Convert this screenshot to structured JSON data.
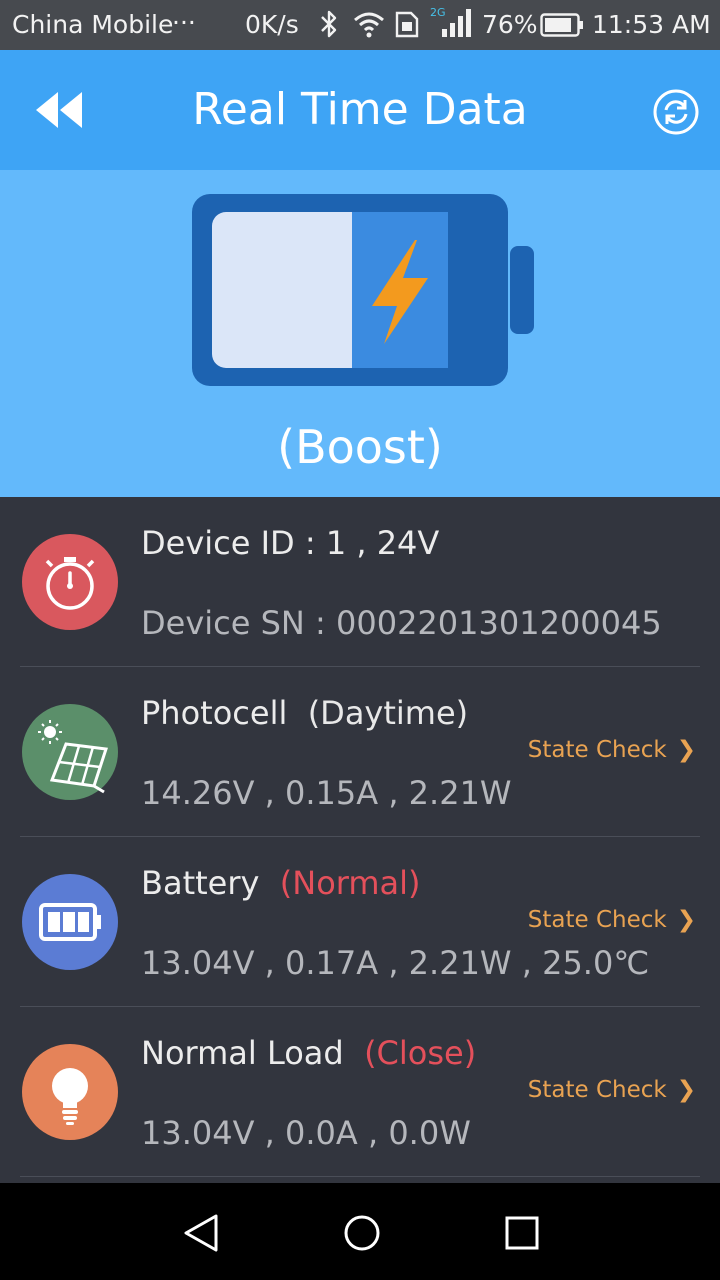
{
  "status_bar": {
    "carrier": "China Mobile",
    "dots": "···",
    "speed": "0K/s",
    "network_label": "2G",
    "battery_percent": "76%",
    "time": "11:53 AM"
  },
  "header": {
    "title": "Real Time Data",
    "back_icon": "double-chevron-left-icon",
    "refresh_icon": "refresh-icon"
  },
  "hero": {
    "mode": "(Boost)",
    "battery_icon": "charging-battery-icon",
    "accent": "#f39a1e"
  },
  "rows": [
    {
      "icon": "stopwatch-icon",
      "color": "#d9585e",
      "title": "Device ID : 1 , 24V",
      "status": "",
      "values": "Device SN : 0002201301200045"
    },
    {
      "icon": "solar-panel-icon",
      "color": "#5b8f6a",
      "title": "Photocell",
      "status": "(Daytime)",
      "values": "14.26V , 0.15A , 2.21W",
      "action": "State Check",
      "chevron": "❯"
    },
    {
      "icon": "battery-icon",
      "color": "#5b7cd4",
      "title": "Battery",
      "status": "(Normal)",
      "values": "13.04V , 0.17A , 2.21W , 25.0℃",
      "action": "State Check",
      "chevron": "❯"
    },
    {
      "icon": "light-bulb-icon",
      "color": "#e58359",
      "title": "Normal Load",
      "status": "(Close)",
      "values": "13.04V , 0.0A , 0.0W",
      "action": "State Check",
      "chevron": "❯"
    }
  ],
  "nav": {
    "back": "back-triangle-icon",
    "home": "home-circle-icon",
    "recents": "recents-square-icon"
  }
}
